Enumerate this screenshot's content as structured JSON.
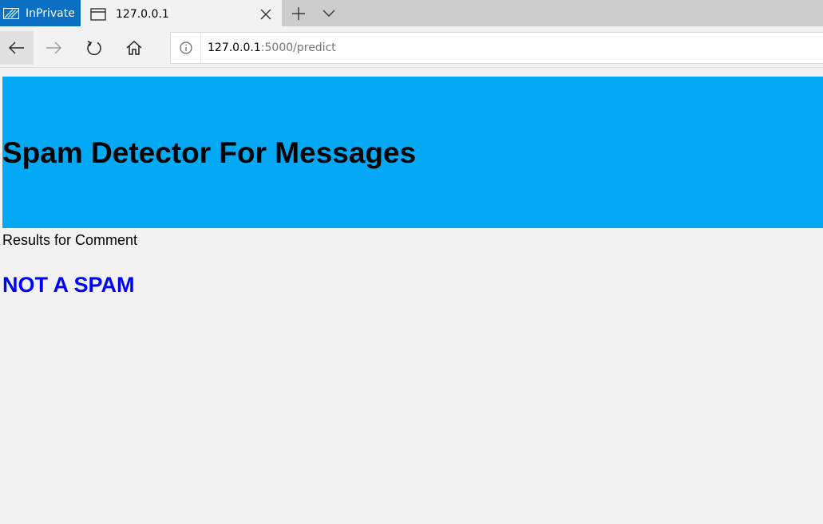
{
  "browser": {
    "inprivate_label": "InPrivate",
    "tab_title": "127.0.0.1",
    "url_host": "127.0.0.1",
    "url_path": ":5000/predict"
  },
  "page": {
    "heading": "Spam Detector For Messages",
    "results_label": "Results for Comment",
    "result": "NOT A SPAM"
  },
  "colors": {
    "banner": "#03a9f4",
    "result_text": "#0000ff",
    "inprivate_bg": "#0a6fc2"
  },
  "icons": {
    "inprivate": "inprivate-icon",
    "tab": "tab-page-icon",
    "close": "close-icon",
    "new_tab": "plus-icon",
    "tab_menu": "chevron-down-icon",
    "back": "back-arrow-icon",
    "forward": "forward-arrow-icon",
    "refresh": "refresh-icon",
    "home": "home-icon",
    "info": "info-icon"
  }
}
